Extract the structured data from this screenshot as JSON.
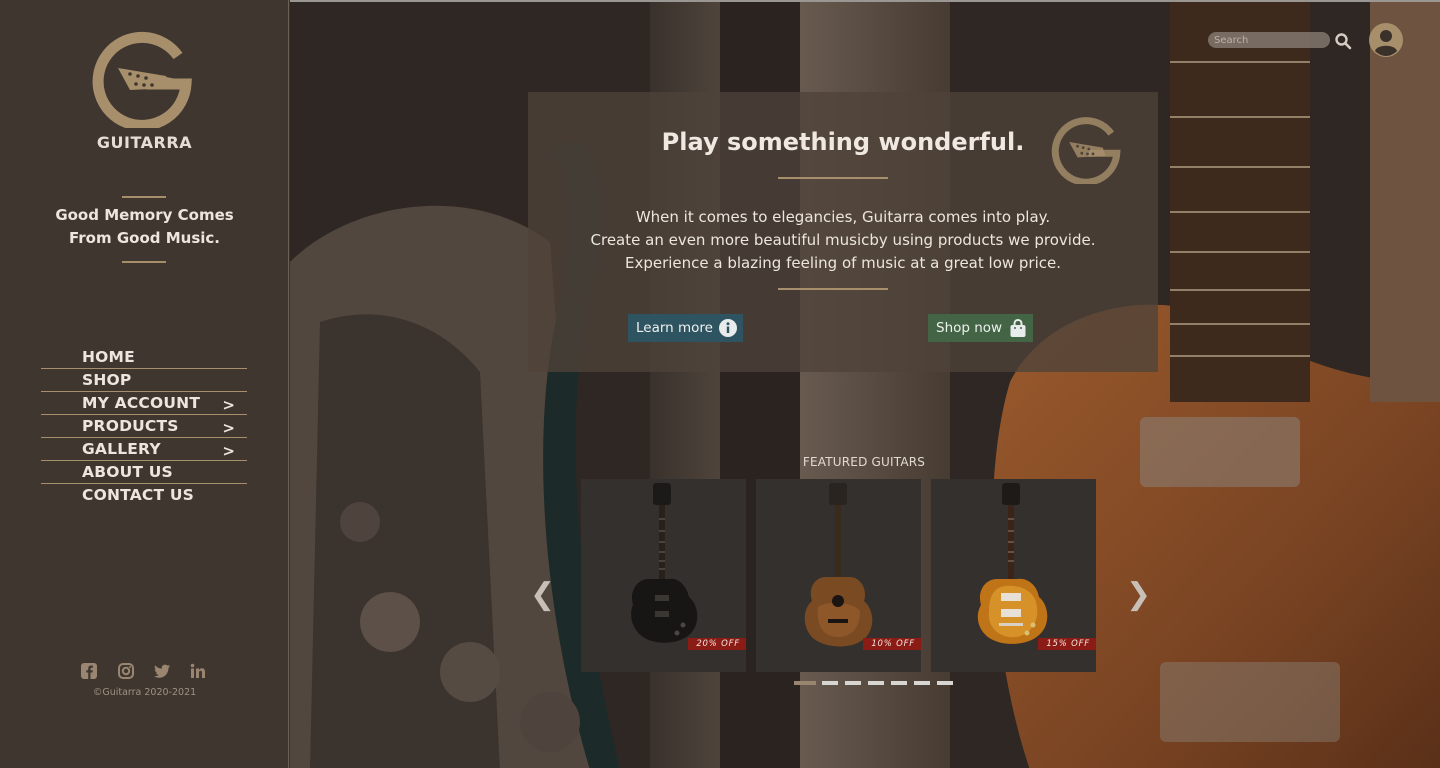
{
  "brand": {
    "name": "GUITARRA"
  },
  "tagline": [
    "Good Memory Comes",
    "From Good Music."
  ],
  "nav": [
    {
      "label": "HOME",
      "arrow": ""
    },
    {
      "label": "SHOP",
      "arrow": ""
    },
    {
      "label": "MY ACCOUNT",
      "arrow": ">"
    },
    {
      "label": "PRODUCTS",
      "arrow": ">"
    },
    {
      "label": "GALLERY",
      "arrow": ">"
    },
    {
      "label": "ABOUT US",
      "arrow": ""
    },
    {
      "label": "CONTACT US",
      "arrow": ""
    }
  ],
  "social": [
    "facebook-icon",
    "instagram-icon",
    "twitter-icon",
    "linkedin-icon"
  ],
  "copyright": "©Guitarra 2020-2021",
  "search": {
    "placeholder": "Search"
  },
  "hero": {
    "title": "Play something wonderful.",
    "lines": [
      "When it comes to elegancies, Guitarra comes into play.",
      "Create an even more beautiful musicby using products we provide.",
      "Experience a blazing feeling of music at a great low price."
    ],
    "learn_more": "Learn more",
    "shop_now": "Shop now"
  },
  "featured": {
    "title": "FEATURED GUITARS",
    "items": [
      {
        "discount": "20% OFF",
        "type": "black-electric-guitar"
      },
      {
        "discount": "10% OFF",
        "type": "acoustic-guitar"
      },
      {
        "discount": "15% OFF",
        "type": "sunburst-electric-guitar"
      }
    ],
    "prev": "❮",
    "next": "❯",
    "slide_count": 7,
    "active_slide": 1
  },
  "colors": {
    "sidebar": "#3f3630",
    "accent": "#a88f6b",
    "learn_button": "#2f5461",
    "shop_button": "#436545",
    "badge": "#8a1b15"
  }
}
